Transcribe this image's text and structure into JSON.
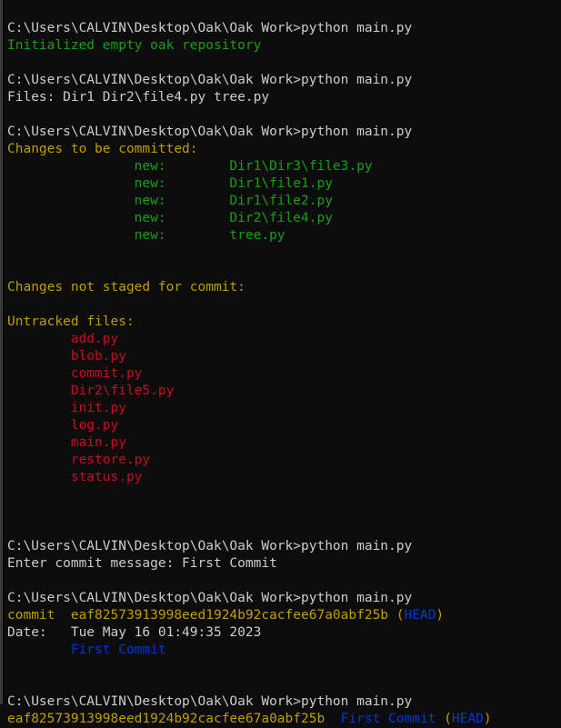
{
  "window": {
    "title": "Command Prompt",
    "background": "#0c0c0c",
    "edge_color": "#3a3a3a"
  },
  "colors": {
    "default": "#cccccc",
    "green": "#13a10e",
    "yellow": "#c19c00",
    "red": "#c50f1f",
    "blue": "#0037da"
  },
  "prompt": "C:\\Users\\CALVIN\\Desktop\\Oak\\Oak Work>",
  "command": "python main.py",
  "lines": [
    {
      "id": "prompt-1",
      "segments": [
        {
          "text": "C:\\Users\\CALVIN\\Desktop\\Oak\\Oak Work>python main.py",
          "color": "default"
        }
      ]
    },
    {
      "id": "init-output",
      "segments": [
        {
          "text": "Initialized empty oak repository",
          "color": "green"
        }
      ]
    },
    {
      "id": "blank-1",
      "segments": [
        {
          "text": "",
          "color": "default"
        }
      ]
    },
    {
      "id": "prompt-2",
      "segments": [
        {
          "text": "C:\\Users\\CALVIN\\Desktop\\Oak\\Oak Work>python main.py",
          "color": "default"
        }
      ]
    },
    {
      "id": "files-output",
      "segments": [
        {
          "text": "Files: Dir1 Dir2\\file4.py tree.py",
          "color": "default"
        }
      ]
    },
    {
      "id": "blank-2",
      "segments": [
        {
          "text": "",
          "color": "default"
        }
      ]
    },
    {
      "id": "prompt-3",
      "segments": [
        {
          "text": "C:\\Users\\CALVIN\\Desktop\\Oak\\Oak Work>python main.py",
          "color": "default"
        }
      ]
    },
    {
      "id": "staged-header",
      "segments": [
        {
          "text": "Changes to be committed:",
          "color": "yellow"
        }
      ]
    },
    {
      "id": "staged-file-1",
      "segments": [
        {
          "text": "                new:        Dir1\\Dir3\\file3.py",
          "color": "green"
        }
      ]
    },
    {
      "id": "staged-file-2",
      "segments": [
        {
          "text": "                new:        Dir1\\file1.py",
          "color": "green"
        }
      ]
    },
    {
      "id": "staged-file-3",
      "segments": [
        {
          "text": "                new:        Dir1\\file2.py",
          "color": "green"
        }
      ]
    },
    {
      "id": "staged-file-4",
      "segments": [
        {
          "text": "                new:        Dir2\\file4.py",
          "color": "green"
        }
      ]
    },
    {
      "id": "staged-file-5",
      "segments": [
        {
          "text": "                new:        tree.py",
          "color": "green"
        }
      ]
    },
    {
      "id": "blank-3",
      "segments": [
        {
          "text": "",
          "color": "default"
        }
      ]
    },
    {
      "id": "blank-4",
      "segments": [
        {
          "text": "",
          "color": "default"
        }
      ]
    },
    {
      "id": "unstaged-header",
      "segments": [
        {
          "text": "Changes not staged for commit:",
          "color": "yellow"
        }
      ]
    },
    {
      "id": "blank-5",
      "segments": [
        {
          "text": "",
          "color": "default"
        }
      ]
    },
    {
      "id": "untracked-header",
      "segments": [
        {
          "text": "Untracked files:",
          "color": "yellow"
        }
      ]
    },
    {
      "id": "untracked-1",
      "segments": [
        {
          "text": "        add.py",
          "color": "red"
        }
      ]
    },
    {
      "id": "untracked-2",
      "segments": [
        {
          "text": "        blob.py",
          "color": "red"
        }
      ]
    },
    {
      "id": "untracked-3",
      "segments": [
        {
          "text": "        commit.py",
          "color": "red"
        }
      ]
    },
    {
      "id": "untracked-4",
      "segments": [
        {
          "text": "        Dir2\\file5.py",
          "color": "red"
        }
      ]
    },
    {
      "id": "untracked-5",
      "segments": [
        {
          "text": "        init.py",
          "color": "red"
        }
      ]
    },
    {
      "id": "untracked-6",
      "segments": [
        {
          "text": "        log.py",
          "color": "red"
        }
      ]
    },
    {
      "id": "untracked-7",
      "segments": [
        {
          "text": "        main.py",
          "color": "red"
        }
      ]
    },
    {
      "id": "untracked-8",
      "segments": [
        {
          "text": "        restore.py",
          "color": "red"
        }
      ]
    },
    {
      "id": "untracked-9",
      "segments": [
        {
          "text": "        status.py",
          "color": "red"
        }
      ]
    },
    {
      "id": "blank-6",
      "segments": [
        {
          "text": "",
          "color": "default"
        }
      ]
    },
    {
      "id": "blank-7",
      "segments": [
        {
          "text": "",
          "color": "default"
        }
      ]
    },
    {
      "id": "blank-8",
      "segments": [
        {
          "text": "",
          "color": "default"
        }
      ]
    },
    {
      "id": "prompt-4",
      "segments": [
        {
          "text": "C:\\Users\\CALVIN\\Desktop\\Oak\\Oak Work>python main.py",
          "color": "default"
        }
      ]
    },
    {
      "id": "commit-message-input",
      "segments": [
        {
          "text": "Enter commit message: First Commit",
          "color": "default"
        }
      ]
    },
    {
      "id": "blank-9",
      "segments": [
        {
          "text": "",
          "color": "default"
        }
      ]
    },
    {
      "id": "prompt-5",
      "segments": [
        {
          "text": "C:\\Users\\CALVIN\\Desktop\\Oak\\Oak Work>python main.py",
          "color": "default"
        }
      ]
    },
    {
      "id": "log-commit-line",
      "segments": [
        {
          "text": "commit  eaf82573913998eed1924b92cacfee67a0abf25b (",
          "color": "yellow"
        },
        {
          "text": "HEAD",
          "color": "blue"
        },
        {
          "text": ")",
          "color": "yellow"
        }
      ]
    },
    {
      "id": "log-date-line",
      "segments": [
        {
          "text": "Date:   Tue May 16 01:49:35 2023",
          "color": "default"
        }
      ]
    },
    {
      "id": "log-message-line",
      "segments": [
        {
          "text": "        First Commit",
          "color": "blue"
        }
      ]
    },
    {
      "id": "blank-10",
      "segments": [
        {
          "text": "",
          "color": "default"
        }
      ]
    },
    {
      "id": "blank-11",
      "segments": [
        {
          "text": "",
          "color": "default"
        }
      ]
    },
    {
      "id": "prompt-6",
      "segments": [
        {
          "text": "C:\\Users\\CALVIN\\Desktop\\Oak\\Oak Work>python main.py",
          "color": "default"
        }
      ]
    },
    {
      "id": "log-oneline",
      "segments": [
        {
          "text": "eaf82573913998eed1924b92cacfee67a0abf25b  ",
          "color": "yellow"
        },
        {
          "text": "First Commit",
          "color": "blue"
        },
        {
          "text": " (",
          "color": "yellow"
        },
        {
          "text": "HEAD",
          "color": "blue"
        },
        {
          "text": ")",
          "color": "yellow"
        }
      ]
    }
  ],
  "commit": {
    "hash": "eaf82573913998eed1924b92cacfee67a0abf25b",
    "ref": "HEAD",
    "date": "Tue May 16 01:49:35 2023",
    "message": "First Commit"
  }
}
